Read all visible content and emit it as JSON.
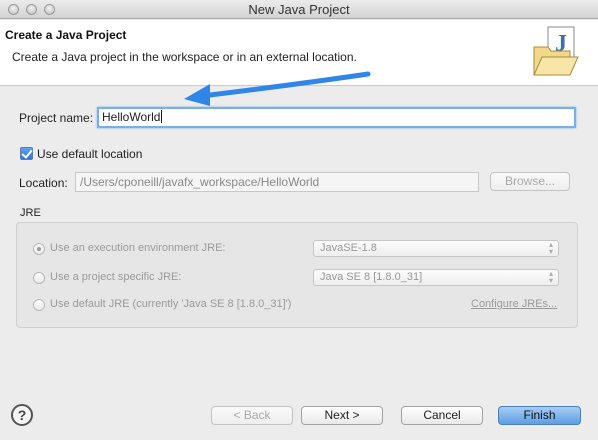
{
  "window": {
    "title": "New Java Project"
  },
  "header": {
    "title": "Create a Java Project",
    "description": "Create a Java project in the workspace or in an external location."
  },
  "project": {
    "name_label": "Project name:",
    "name_value": "HelloWorld",
    "use_default_location_label": "Use default location",
    "use_default_location_checked": true,
    "location_label": "Location:",
    "location_value": "/Users/cponeill/javafx_workspace/HelloWorld",
    "browse_label": "Browse..."
  },
  "jre": {
    "group_label": "JRE",
    "options": [
      {
        "label": "Use an execution environment JRE:",
        "selected": true,
        "value": "JavaSE-1.8"
      },
      {
        "label": "Use a project specific JRE:",
        "selected": false,
        "value": "Java SE 8 [1.8.0_31]"
      },
      {
        "label": "Use default JRE (currently 'Java SE 8 [1.8.0_31]')",
        "selected": false
      }
    ],
    "configure_link": "Configure JREs..."
  },
  "footer": {
    "back_label": "< Back",
    "next_label": "Next >",
    "cancel_label": "Cancel",
    "finish_label": "Finish",
    "help_icon": "?"
  },
  "colors": {
    "accent": "#2f86e8",
    "annotation_arrow": "#2f86e8"
  }
}
